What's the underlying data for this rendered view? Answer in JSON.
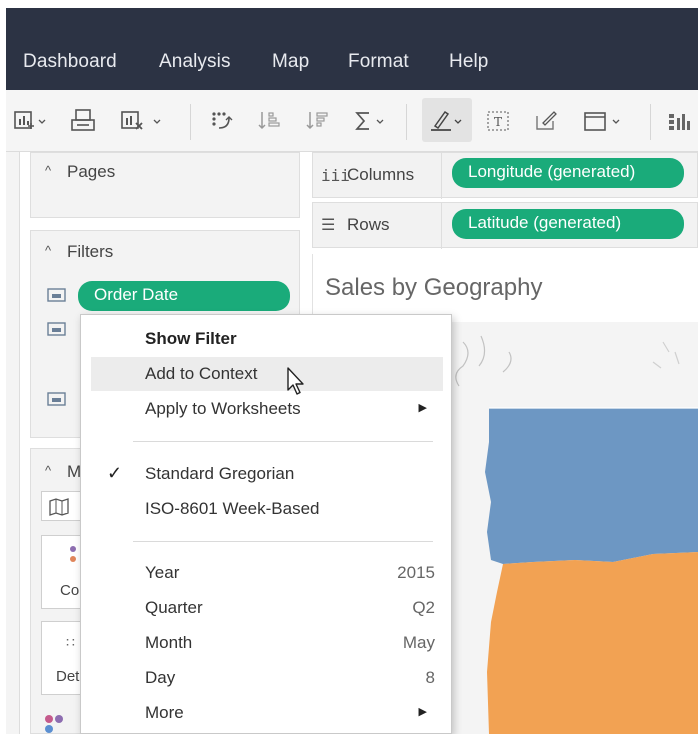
{
  "menubar": {
    "items": [
      "Dashboard",
      "Analysis",
      "Map",
      "Format",
      "Help"
    ]
  },
  "toolbar": {
    "icons": [
      "new-worksheet-icon",
      "new-dashboard-icon",
      "clear-sheet-icon",
      "swap-icon",
      "sort-ascending-icon",
      "sort-descending-icon",
      "totals-icon",
      "highlight-icon",
      "labels-icon",
      "annotate-icon",
      "fit-icon",
      "show-me-icon"
    ]
  },
  "pages_panel": {
    "title": "Pages"
  },
  "filters_panel": {
    "title": "Filters",
    "pill": "Order Date"
  },
  "marks_panel": {
    "title_fragment": "M",
    "card_labels": [
      "Co",
      "Det"
    ]
  },
  "shelves": {
    "columns_label": "Columns",
    "columns_pill": "Longitude (generated)",
    "rows_label": "Rows",
    "rows_pill": "Latitude (generated)"
  },
  "sheet": {
    "title": "Sales by Geography"
  },
  "context_menu": {
    "show_filter": "Show Filter",
    "add_to_context": "Add to Context",
    "apply_to_worksheets": "Apply to Worksheets",
    "standard_gregorian": "Standard Gregorian",
    "iso_week": "ISO-8601 Week-Based",
    "year_label": "Year",
    "year_value": "2015",
    "quarter_label": "Quarter",
    "quarter_value": "Q2",
    "month_label": "Month",
    "month_value": "May",
    "day_label": "Day",
    "day_value": "8",
    "more_label": "More"
  },
  "colors": {
    "menubar_bg": "#2c3344",
    "pill_green": "#1aab7a",
    "map_blue": "#6d97c3",
    "map_orange": "#f2a253"
  }
}
